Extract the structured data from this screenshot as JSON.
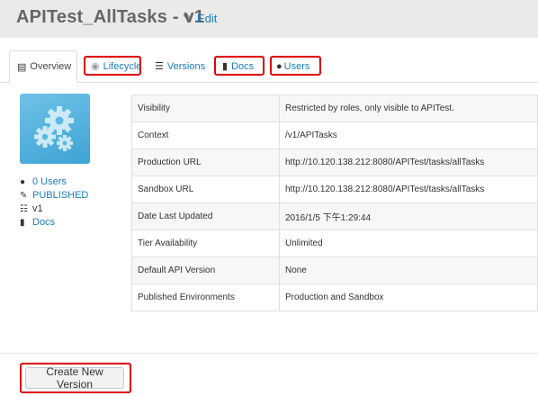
{
  "header": {
    "title": "APITest_AllTasks - v1",
    "edit_label": "Edit"
  },
  "tabs": [
    {
      "label": "Overview",
      "icon": "list-icon",
      "active": true
    },
    {
      "label": "Lifecycle",
      "icon": "lifecycle-icon",
      "highlighted": true
    },
    {
      "label": "Versions",
      "icon": "versions-icon"
    },
    {
      "label": "Docs",
      "icon": "document-icon",
      "highlighted": true
    },
    {
      "label": "Users",
      "icon": "user-icon",
      "highlighted": true
    }
  ],
  "sidebar": {
    "users": "0 Users",
    "status": "PUBLISHED",
    "version": "v1",
    "docs": "Docs"
  },
  "info_table": [
    {
      "key": "Visibility",
      "value": "Restricted by roles, only visible to APITest."
    },
    {
      "key": "Context",
      "value": "/v1/APITasks"
    },
    {
      "key": "Production URL",
      "value": "http://10.120.138.212:8080/APITest/tasks/allTasks"
    },
    {
      "key": "Sandbox URL",
      "value": "http://10.120.138.212:8080/APITest/tasks/allTasks"
    },
    {
      "key": "Date Last Updated",
      "value": "2016/1/5 下午1:29:44"
    },
    {
      "key": "Tier Availability",
      "value": "Unlimited"
    },
    {
      "key": "Default API Version",
      "value": "None"
    },
    {
      "key": "Published Environments",
      "value": "Production and Sandbox"
    }
  ],
  "actions": {
    "create_version_label": "Create New Version"
  },
  "colors": {
    "link": "#1a7bb9",
    "highlight_box": "#e00000",
    "header_bg": "#eaeaea"
  }
}
